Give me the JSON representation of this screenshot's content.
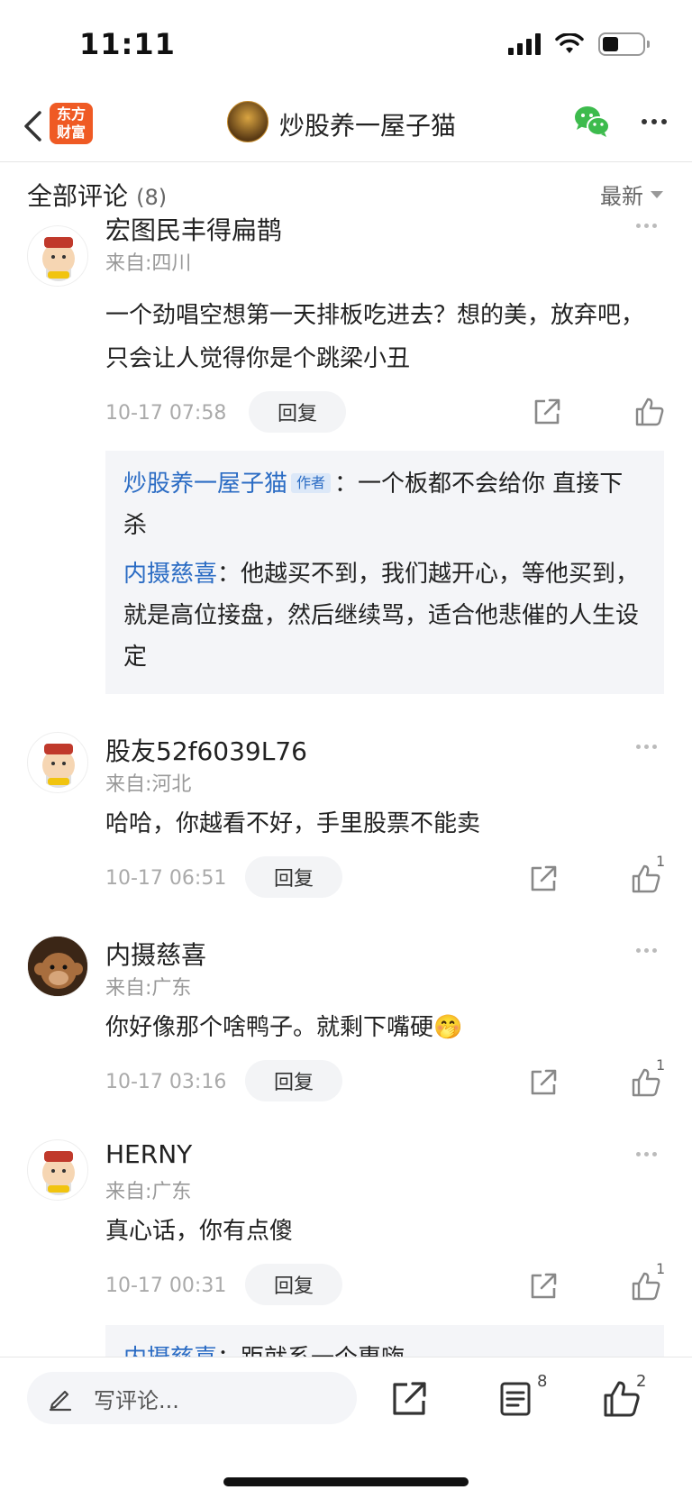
{
  "status_bar": {
    "time": "11:11"
  },
  "nav": {
    "brand": "东方财富",
    "brand_line1": "东方",
    "brand_line2": "财富",
    "title": "炒股养一屋子猫"
  },
  "section": {
    "title": "全部评论",
    "count": "(8)",
    "sort_label": "最新"
  },
  "comments": [
    {
      "username": "宏图民丰得扁鹊",
      "location": "来自:四川",
      "content": "一个劲唱空想第一天排板吃进去？想的美，放弃吧，只会让人觉得你是个跳梁小丑",
      "time": "10-17 07:58",
      "reply_label": "回复",
      "like_count": "",
      "replies": [
        {
          "user": "炒股养一屋子猫",
          "badge": "作者",
          "sep": "：",
          "text": "一个板都不会给你 直接下杀"
        },
        {
          "user": "内摄慈喜",
          "badge": "",
          "sep": "：",
          "text": "他越买不到，我们越开心，等他买到，就是高位接盘，然后继续骂，适合他悲催的人生设定"
        }
      ]
    },
    {
      "username": "股友52f6039L76",
      "location": "来自:河北",
      "content": "哈哈，你越看不好，手里股票不能卖",
      "time": "10-17 06:51",
      "reply_label": "回复",
      "like_count": "1"
    },
    {
      "username": "内摄慈喜",
      "location": "来自:广东",
      "content": "你好像那个啥鸭子。就剩下嘴硬🤭",
      "time": "10-17 03:16",
      "reply_label": "回复",
      "like_count": "1"
    },
    {
      "username": "HERNY",
      "location": "来自:广东",
      "content": "真心话，你有点傻",
      "time": "10-17 00:31",
      "reply_label": "回复",
      "like_count": "1",
      "partial_reply": {
        "user": "内摄慈喜",
        "sep": "：",
        "text": "距就系一个惠嗨"
      }
    }
  ],
  "bottom_bar": {
    "input_placeholder": "写评论...",
    "comment_count": "8",
    "like_count": "2"
  },
  "colors": {
    "brand": "#ef5a24",
    "link": "#2b6cc4",
    "wechat": "#3dbb4d"
  }
}
